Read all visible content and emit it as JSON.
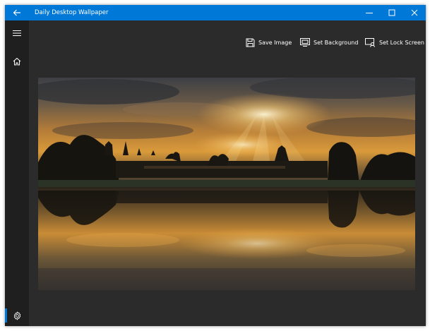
{
  "window": {
    "title": "Daily Desktop Wallpaper"
  },
  "toolbar": {
    "save_label": "Save Image",
    "background_label": "Set Background",
    "lock_label": "Set Lock Screen"
  },
  "sidebar": {
    "items": [
      "menu-icon",
      "home-icon",
      "settings-icon"
    ]
  },
  "colors": {
    "accent": "#0078d7",
    "background": "#2b2b2b",
    "sidebar": "#1f1f1f"
  }
}
